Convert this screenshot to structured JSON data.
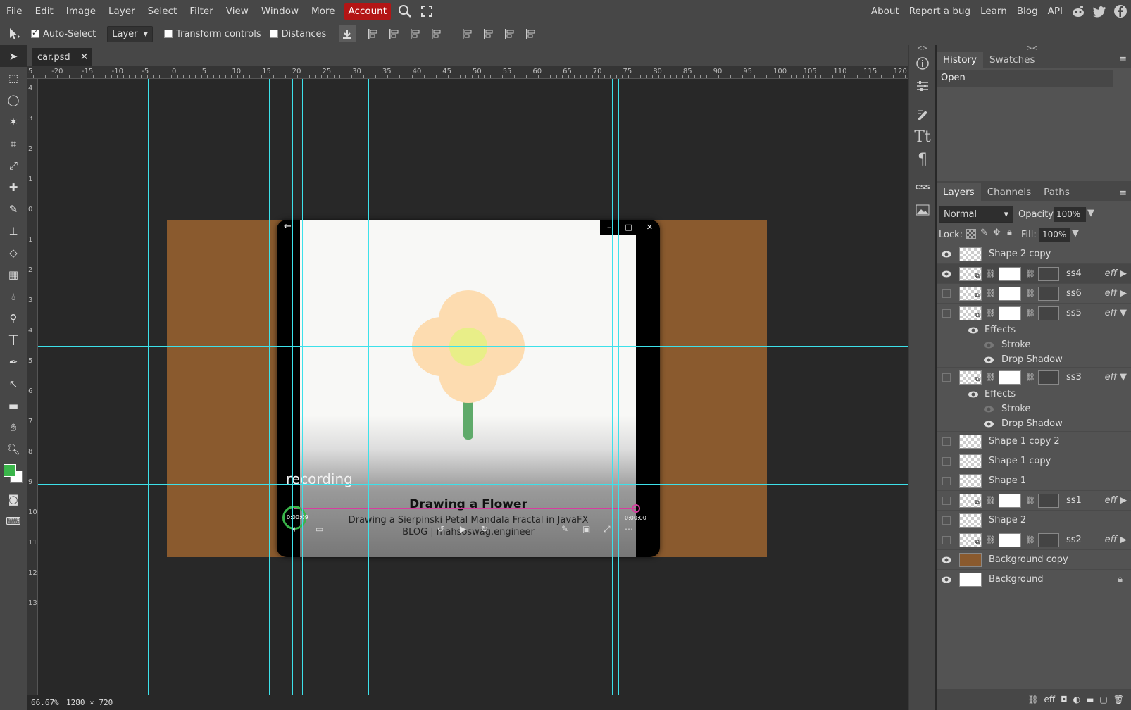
{
  "menu": {
    "items": [
      "File",
      "Edit",
      "Image",
      "Layer",
      "Select",
      "Filter",
      "View",
      "Window",
      "More"
    ],
    "account": "Account",
    "right_items": [
      "About",
      "Report a bug",
      "Learn",
      "Blog",
      "API"
    ]
  },
  "options": {
    "auto_select_label": "Auto-Select",
    "auto_select_checked": true,
    "layer_select": "Layer",
    "transform_controls_label": "Transform controls",
    "distances_label": "Distances"
  },
  "document": {
    "tab_name": "car.psd",
    "zoom": "66.67%",
    "size": "1280 × 720"
  },
  "ruler": {
    "h_ticks": [
      "5",
      "-20",
      "-15",
      "-10",
      "-5",
      "0",
      "5",
      "10",
      "15",
      "20",
      "25",
      "30",
      "35",
      "40",
      "45",
      "50",
      "55",
      "60",
      "65",
      "70",
      "75",
      "80",
      "85",
      "90",
      "95",
      "100",
      "105",
      "110",
      "115",
      "120"
    ],
    "v_ticks": [
      "4",
      "3",
      "2",
      "1",
      "0",
      "1",
      "2",
      "3",
      "4",
      "5",
      "6",
      "7",
      "8",
      "9",
      "10",
      "11",
      "12",
      "13"
    ]
  },
  "canvas": {
    "recording_label": "recording",
    "video_title": "Drawing a Flower",
    "video_subtitle_line1": "Drawing a Sierpinski Petal Mandala Fractal in JavaFX",
    "video_subtitle_line2": "BLOG | mahsoswag.engineer",
    "time_left": "0:00:09",
    "time_right": "0:00:00",
    "colors": {
      "brown": "#8a5a2e",
      "guide": "#3de1ea",
      "petal": "#fddcb0",
      "center": "#e8ee88",
      "stem": "#5faa6a",
      "progress": "#d63e9f",
      "ring": "#3ab54a"
    }
  },
  "history": {
    "tabs": [
      "History",
      "Swatches"
    ],
    "entries": [
      "Open"
    ]
  },
  "layers_panel": {
    "tabs": [
      "Layers",
      "Channels",
      "Paths"
    ],
    "blend_mode": "Normal",
    "opacity_label": "Opacity:",
    "opacity": "100%",
    "lock_label": "Lock:",
    "fill_label": "Fill:",
    "fill": "100%",
    "effects_label": "Effects",
    "eff_label": "eff",
    "layers": [
      {
        "name": "Shape 2 copy",
        "visible": true,
        "type": "shape"
      },
      {
        "name": "ss4",
        "visible": true,
        "type": "smart",
        "fx": true,
        "expanded": false,
        "selected": true
      },
      {
        "name": "ss6",
        "visible": false,
        "type": "smart",
        "fx": true,
        "expanded": false
      },
      {
        "name": "ss5",
        "visible": false,
        "type": "smart",
        "fx": true,
        "expanded": true,
        "effects": [
          "Stroke",
          "Drop Shadow"
        ]
      },
      {
        "name": "ss3",
        "visible": false,
        "type": "smart",
        "fx": true,
        "expanded": true,
        "effects": [
          "Stroke",
          "Drop Shadow"
        ]
      },
      {
        "name": "Shape 1 copy 2",
        "visible": false,
        "type": "shape"
      },
      {
        "name": "Shape 1 copy",
        "visible": false,
        "type": "shape"
      },
      {
        "name": "Shape 1",
        "visible": false,
        "type": "shape"
      },
      {
        "name": "ss1",
        "visible": false,
        "type": "smart",
        "fx": true,
        "expanded": false
      },
      {
        "name": "Shape 2",
        "visible": false,
        "type": "shape"
      },
      {
        "name": "ss2",
        "visible": false,
        "type": "smart",
        "fx": true,
        "expanded": false
      },
      {
        "name": "Background copy",
        "visible": true,
        "type": "brown"
      },
      {
        "name": "Background",
        "visible": true,
        "type": "white",
        "locked": true
      }
    ]
  },
  "minicol": {
    "css_label": "CSS"
  },
  "colors": {
    "foreground": "#3ab54a",
    "background": "#ffffff"
  }
}
